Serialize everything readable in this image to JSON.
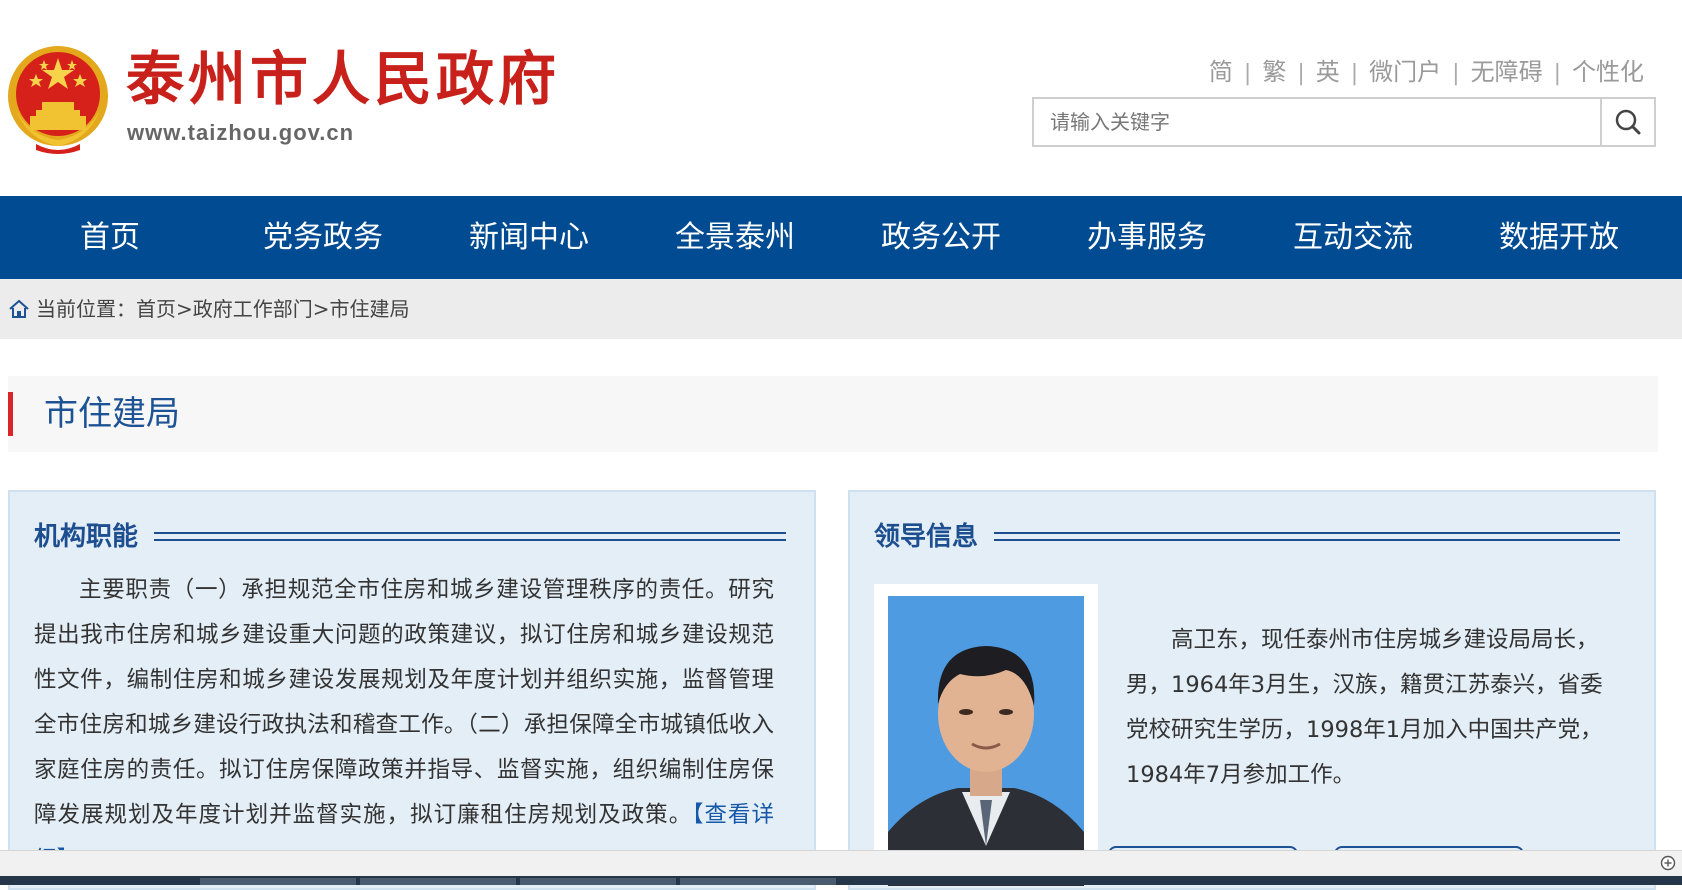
{
  "header": {
    "site_name": "泰州市人民政府",
    "site_url_prefix": "www.",
    "site_url_domain": "taizhou",
    "site_url_suffix": ".gov.cn",
    "lang_links": [
      "简",
      "繁",
      "英",
      "微门户",
      "无障碍",
      "个性化"
    ],
    "search": {
      "placeholder": "请输入关键字",
      "value": ""
    }
  },
  "nav": {
    "items": [
      "首页",
      "党务政务",
      "新闻中心",
      "全景泰州",
      "政务公开",
      "办事服务",
      "互动交流",
      "数据开放"
    ]
  },
  "breadcrumb": {
    "label": "当前位置：",
    "items": [
      "首页",
      "政府工作部门",
      "市住建局"
    ],
    "separator": ">"
  },
  "page": {
    "title": "市住建局"
  },
  "functions": {
    "heading": "机构职能",
    "text": "主要职责（一）承担规范全市住房和城乡建设管理秩序的责任。研究提出我市住房和城乡建设重大问题的政策建议，拟订住房和城乡建设规范性文件，编制住房和城乡建设发展规划及年度计划并组织实施，监督管理全市住房和城乡建设行政执法和稽查工作。（二）承担保障全市城镇低收入家庭住房的责任。拟订住房保障政策并指导、监督实施，组织编制住房保障发展规划及年度计划并监督实施，拟订廉租住房规划及政策。",
    "more_link": "【查看详细】"
  },
  "leader": {
    "heading": "领导信息",
    "bio": "高卫东，现任泰州市住房城乡建设局局长，男，1964年3月生，汉族，籍贯江苏泰兴，省委党校研究生学历，1998年1月加入中国共产党，1984年7月参加工作。"
  },
  "colors": {
    "brand_red": "#c8211b",
    "nav_blue": "#004b91",
    "heading_blue": "#1d4e8f",
    "panel_bg": "#e4eef6"
  },
  "icons": [
    "national-emblem",
    "search-icon",
    "home-icon",
    "zoom-icon"
  ]
}
